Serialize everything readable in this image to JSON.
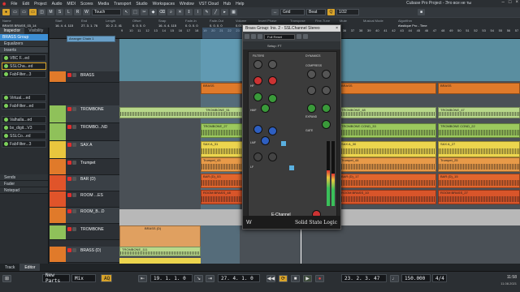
{
  "app": {
    "title": "Cubase Pro Project - Это все не ты",
    "menus": [
      "File",
      "Edit",
      "Project",
      "Audio",
      "MIDI",
      "Scores",
      "Media",
      "Transport",
      "Studio",
      "Workspaces",
      "Window",
      "VST Cloud",
      "Hub",
      "Help"
    ]
  },
  "toolbar": {
    "touch_mode": "Touch",
    "grid_mode": "Grid",
    "grid_value": "Beat",
    "quantize": "1/32"
  },
  "infoline": {
    "headers": [
      "Name",
      "Start",
      "End",
      "Length",
      "Offset",
      "Snap",
      "Fade-In",
      "Fade-Out",
      "Volume",
      "Invert Phase",
      "Transpose",
      "Fine-Tune",
      "Mute",
      "Musical Mode",
      "Algorithm"
    ],
    "values": [
      "BRASS BRASS_03_14",
      "16. 4. 4. 115",
      "27. 3. 1. 76",
      "10. 2. 2. 41",
      "0. 0. 0. 0",
      "16. 4. 4. 115",
      "0. 0. 0. 0",
      "0. 0. 0. 0",
      "0.00 dB",
      "",
      "0",
      "0",
      "",
      "",
      "élastique Pro - Time"
    ]
  },
  "inspector": {
    "tabs": [
      "Inspector",
      "Visibility"
    ],
    "track_name": "BRASS Group",
    "sections": [
      "Equalizers",
      "Sends",
      "Fader",
      "Notepad"
    ],
    "inserts_title": "Inserts",
    "inserts": [
      "VBC F...ed",
      "SSLCha...ed",
      "FabFilter...3",
      "Virtual....ed",
      "FabFilter...ed",
      "Valhalla...ed",
      "bx_digit...V3",
      "SSLCo...ed",
      "FabFilter...3"
    ]
  },
  "tracks": [
    {
      "name": "BRASS",
      "color": "#e07a2a"
    },
    {
      "name": "TROMBONE",
      "color": "#8fc15a"
    },
    {
      "name": "TROMBO...ND",
      "color": "#8fc15a"
    },
    {
      "name": "SAX A",
      "color": "#e8c63e"
    },
    {
      "name": "Trumpet",
      "color": "#e07a2a"
    },
    {
      "name": "BAR (D)",
      "color": "#e0542a"
    },
    {
      "name": "ROOM ...ES",
      "color": "#e0542a"
    },
    {
      "name": "ROOM_B...D",
      "color": "#e07a2a"
    },
    {
      "name": "TROMBONE",
      "color": "#8fc15a"
    },
    {
      "name": "BRASS (D)",
      "color": "#e07a2a"
    }
  ],
  "ruler": [
    "9",
    "10",
    "11",
    "12",
    "13",
    "14",
    "15",
    "16",
    "17",
    "18",
    "19",
    "20",
    "21",
    "22",
    "23",
    "24",
    "25",
    "26",
    "27",
    "28",
    "29",
    "30",
    "31",
    "32",
    "33",
    "34",
    "35",
    "36",
    "37",
    "38",
    "39",
    "40",
    "41",
    "42",
    "43",
    "44",
    "45",
    "46",
    "47",
    "48",
    "49",
    "50",
    "51",
    "52",
    "53",
    "54",
    "55",
    "56",
    "57"
  ],
  "parts": {
    "brass": "BRASS",
    "trombone_51": "TROMBONE_51",
    "trombone_48": "TROMBONE_48",
    "trombone_47": "TROMBONE_47",
    "trombone_cond_27": "TROMBONE_27",
    "trombone_cond_33": "TROMBONE COND_33",
    "trombone_cond_22": "TROMBONE COND_22",
    "sax_31": "SAX A_31",
    "sax_30": "SAX A_30",
    "sax_27": "SAX A_27",
    "trumpet_43": "Trumpet_43",
    "trumpet_44": "Trumpet_44",
    "trumpet_25": "Trumpet_25",
    "bar_53": "BAR (D)_53",
    "bar_17": "BAR (D)_17",
    "bar_15": "BAR (D)_15",
    "room_48": "ROOM BRASS_48",
    "room_10": "ROOM BRASS_10",
    "room_27": "ROOM BRASS_27",
    "tromb_111": "TROMBONE_111",
    "brass_d1": "BRASS (D)",
    "arranger": "Arranger Chain 1"
  },
  "plugin": {
    "title": "Brass Group: Ins. 2 - SSLChannel Stereo",
    "preset": "Full Reset",
    "setup": "Setup: FT",
    "sections": [
      "FILTERS",
      "DYNAMICS",
      "COMPRESS",
      "EXPAND",
      "GATE",
      "HMF",
      "LMF",
      "LF",
      "HF"
    ],
    "brand": "E-Channel",
    "footer": "Solid State Logic"
  },
  "transport": {
    "left_locator": "19. 1. 1. 0",
    "right_locator": "27. 4. 1. 0",
    "position": "23. 2. 3. 47",
    "tempo": "150.000",
    "signature": "4/4",
    "bottom_tabs": [
      "Track",
      "Editor"
    ],
    "new_parts": "New Parts",
    "mix": "Mix",
    "zoom": "AQ"
  },
  "clock": {
    "time": "11:58",
    "date": "11.08.2021"
  }
}
